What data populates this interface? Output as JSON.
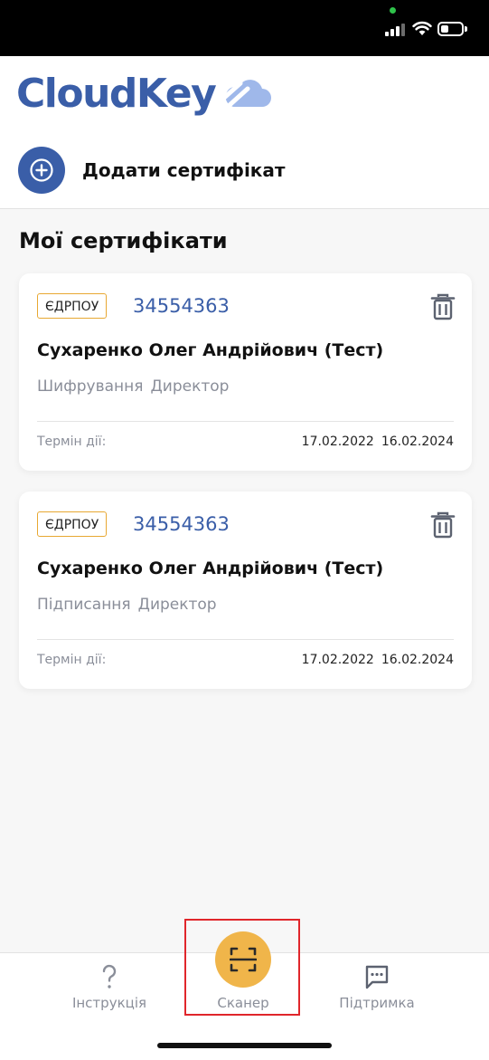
{
  "colors": {
    "brand": "#3a5ea8",
    "brand_light": "#9fb8ea",
    "accent_scanner": "#f0b54a",
    "status_green": "#2fc24a",
    "badge_border": "#e8a832",
    "highlight": "#e0262b"
  },
  "status_bar": {
    "battery_level_percent": 40
  },
  "header": {
    "logo_text": "CloudKey",
    "add_certificate_label": "Додати сертифікат"
  },
  "main": {
    "section_title": "Мої сертифікати",
    "certificates": [
      {
        "badge": "ЄДРПОУ",
        "code": "34554363",
        "name": "Сухаренко Олег Андрійович (Тест)",
        "roles": [
          "Шифрування",
          "Директор"
        ],
        "term_label": "Термін дії:",
        "date_from": "17.02.2022",
        "date_to": "16.02.2024"
      },
      {
        "badge": "ЄДРПОУ",
        "code": "34554363",
        "name": "Сухаренко Олег Андрійович (Тест)",
        "roles": [
          "Підписання",
          "Директор"
        ],
        "term_label": "Термін дії:",
        "date_from": "17.02.2022",
        "date_to": "16.02.2024"
      }
    ]
  },
  "bottom_nav": {
    "items": [
      {
        "label": "Інструкція",
        "icon": "question-icon"
      },
      {
        "label": "Сканер",
        "icon": "scanner-icon"
      },
      {
        "label": "Підтримка",
        "icon": "chat-icon"
      }
    ]
  }
}
